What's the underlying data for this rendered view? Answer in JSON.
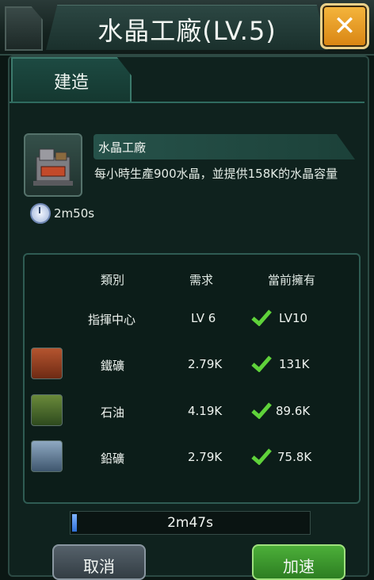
{
  "window": {
    "title": "水晶工廠(LV.5)"
  },
  "tabs": [
    {
      "label": "建造"
    }
  ],
  "building": {
    "name": "水晶工廠",
    "description": "每小時生產900水晶，並提供158K的水晶容量",
    "build_time": "2m50s"
  },
  "requirements": {
    "headers": {
      "category": "類別",
      "required": "需求",
      "current": "當前擁有"
    },
    "rows": [
      {
        "label": "指揮中心",
        "required": "LV 6",
        "current": "LV10",
        "icon": ""
      },
      {
        "label": "鐵礦",
        "required": "2.79K",
        "current": "131K",
        "icon": "iron-ore-icon"
      },
      {
        "label": "石油",
        "required": "4.19K",
        "current": "89.6K",
        "icon": "oil-icon"
      },
      {
        "label": "鉛礦",
        "required": "2.79K",
        "current": "75.8K",
        "icon": "lead-ore-icon"
      }
    ]
  },
  "progress": {
    "text": "2m47s",
    "fraction": 0.02
  },
  "buttons": {
    "cancel": "取消",
    "speedup": "加速"
  },
  "colors": {
    "check": "#5fd23a",
    "close_button": "#f0a12a",
    "speedup_button": "#3f9a2f"
  }
}
